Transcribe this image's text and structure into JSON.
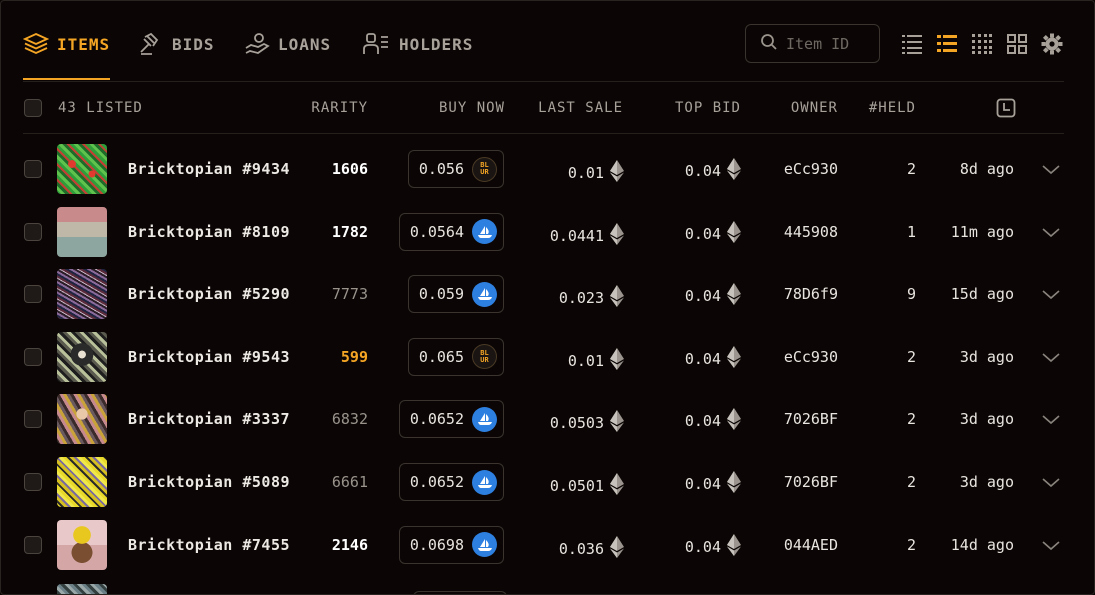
{
  "nav": {
    "tabs": [
      {
        "label": "ITEMS",
        "icon": "layers-icon",
        "active": true
      },
      {
        "label": "BIDS",
        "icon": "gavel-icon",
        "active": false
      },
      {
        "label": "LOANS",
        "icon": "hand-coin-icon",
        "active": false
      },
      {
        "label": "HOLDERS",
        "icon": "users-icon",
        "active": false
      }
    ],
    "search_placeholder": "Item ID",
    "accent_color": "#f5a524"
  },
  "table": {
    "listed_label": "43 LISTED",
    "columns": {
      "rarity": "RARITY",
      "buy_now": "BUY NOW",
      "last_sale": "LAST SALE",
      "top_bid": "TOP BID",
      "owner": "OWNER",
      "held": "#HELD"
    },
    "rows": [
      {
        "name": "Bricktopian #9434",
        "rarity": "1606",
        "rarity_style": "bold",
        "buy_now": "0.056",
        "marketplace": "blur",
        "last_sale": "0.01",
        "top_bid": "0.04",
        "owner": "eCc930",
        "held": "2",
        "ago": "8d ago"
      },
      {
        "name": "Bricktopian #8109",
        "rarity": "1782",
        "rarity_style": "bold",
        "buy_now": "0.0564",
        "marketplace": "opensea",
        "last_sale": "0.0441",
        "top_bid": "0.04",
        "owner": "445908",
        "held": "1",
        "ago": "11m ago"
      },
      {
        "name": "Bricktopian #5290",
        "rarity": "7773",
        "rarity_style": "dim",
        "buy_now": "0.059",
        "marketplace": "opensea",
        "last_sale": "0.023",
        "top_bid": "0.04",
        "owner": "78D6f9",
        "held": "9",
        "ago": "15d ago"
      },
      {
        "name": "Bricktopian #9543",
        "rarity": "599",
        "rarity_style": "orange",
        "buy_now": "0.065",
        "marketplace": "blur",
        "last_sale": "0.01",
        "top_bid": "0.04",
        "owner": "eCc930",
        "held": "2",
        "ago": "3d ago"
      },
      {
        "name": "Bricktopian #3337",
        "rarity": "6832",
        "rarity_style": "dim",
        "buy_now": "0.0652",
        "marketplace": "opensea",
        "last_sale": "0.0503",
        "top_bid": "0.04",
        "owner": "7026BF",
        "held": "2",
        "ago": "3d ago"
      },
      {
        "name": "Bricktopian #5089",
        "rarity": "6661",
        "rarity_style": "dim",
        "buy_now": "0.0652",
        "marketplace": "opensea",
        "last_sale": "0.0501",
        "top_bid": "0.04",
        "owner": "7026BF",
        "held": "2",
        "ago": "3d ago"
      },
      {
        "name": "Bricktopian #7455",
        "rarity": "2146",
        "rarity_style": "bold",
        "buy_now": "0.0698",
        "marketplace": "opensea",
        "last_sale": "0.036",
        "top_bid": "0.04",
        "owner": "044AED",
        "held": "2",
        "ago": "14d ago"
      }
    ]
  },
  "marketplace_badges": {
    "blur": "BL\nUR"
  },
  "colors": {
    "rarity_orange": "#f5a524",
    "opensea_blue": "#2d7fe0"
  }
}
